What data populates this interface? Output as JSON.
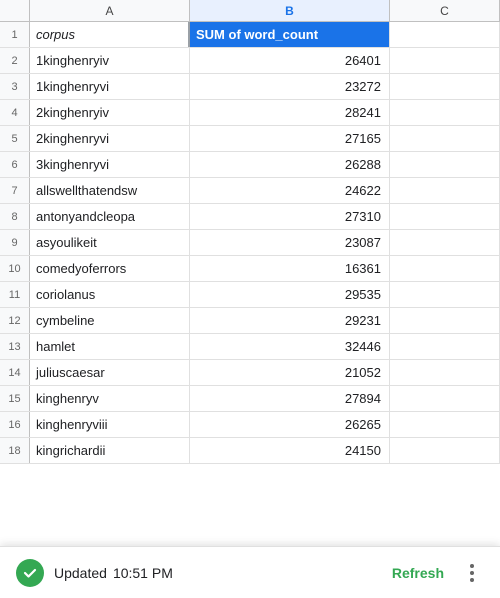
{
  "columns": {
    "a": "A",
    "b": "B",
    "c": "C"
  },
  "header_row": {
    "col_a": "corpus",
    "col_b": "SUM of word_count"
  },
  "rows": [
    {
      "num": 2,
      "corpus": "1kinghenryiv",
      "word_count": "26401"
    },
    {
      "num": 3,
      "corpus": "1kinghenryvi",
      "word_count": "23272"
    },
    {
      "num": 4,
      "corpus": "2kinghenryiv",
      "word_count": "28241"
    },
    {
      "num": 5,
      "corpus": "2kinghenryvi",
      "word_count": "27165"
    },
    {
      "num": 6,
      "corpus": "3kinghenryvi",
      "word_count": "26288"
    },
    {
      "num": 7,
      "corpus": "allswellthatendsw",
      "word_count": "24622"
    },
    {
      "num": 8,
      "corpus": "antonyandcleopa",
      "word_count": "27310"
    },
    {
      "num": 9,
      "corpus": "asyoulikeit",
      "word_count": "23087"
    },
    {
      "num": 10,
      "corpus": "comedyoferrors",
      "word_count": "16361"
    },
    {
      "num": 11,
      "corpus": "coriolanus",
      "word_count": "29535"
    },
    {
      "num": 12,
      "corpus": "cymbeline",
      "word_count": "29231"
    },
    {
      "num": 13,
      "corpus": "hamlet",
      "word_count": "32446"
    },
    {
      "num": 14,
      "corpus": "juliuscaesar",
      "word_count": "21052"
    },
    {
      "num": 15,
      "corpus": "kinghenryv",
      "word_count": "27894"
    },
    {
      "num": 16,
      "corpus": "kinghenryviii",
      "word_count": "26265"
    },
    {
      "num": 18,
      "corpus": "kingrichardii",
      "word_count": "24150"
    }
  ],
  "status_bar": {
    "status_text": "Updated",
    "time": "10:51 PM",
    "refresh_label": "Refresh"
  }
}
